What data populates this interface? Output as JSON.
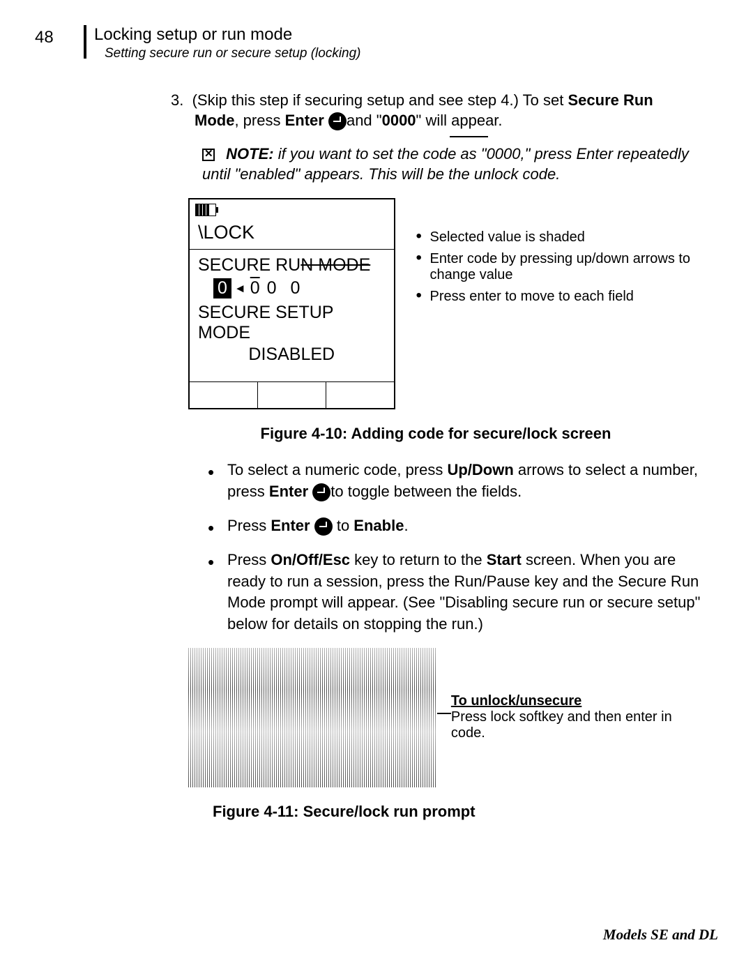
{
  "page_number": "48",
  "header": {
    "title": "Locking setup or run mode",
    "subtitle": "Setting secure run or secure setup (locking)"
  },
  "step3": {
    "number": "3.",
    "text_a": "(Skip this step if securing setup and see step 4.)   To set ",
    "text_b": "Secure Run Mode",
    "text_c": ", press ",
    "text_d": "Enter ",
    "text_e": "and \"",
    "text_f": "0000",
    "text_g": "\" will appear."
  },
  "note": {
    "label": "NOTE:",
    "text": "if you want to set the code as \"0000,\" press Enter repeatedly until \"enabled\" appears.  This will be the unlock code."
  },
  "lock_screen": {
    "title": "\\LOCK",
    "secure_run_a": "SECURE RU",
    "secure_run_b": "N MODE",
    "code_selected": "0",
    "code_d2": "0",
    "code_d3": "0",
    "code_d4": "0",
    "secure_setup": "SECURE SETUP MODE",
    "disabled": "DISABLED"
  },
  "annotations": {
    "item1": "Selected value is shaded",
    "item2": "Enter code by pressing up/down arrows to change value",
    "item3": "Press enter to move to each field"
  },
  "figure410": "Figure 4-10:  Adding code for secure/lock screen",
  "bullets": {
    "b1_a": "To select a numeric code, press ",
    "b1_b": "Up/Down",
    "b1_c": " arrows to select a number, press ",
    "b1_d": "Enter ",
    "b1_e": "to toggle between the fields.",
    "b2_a": "Press ",
    "b2_b": "Enter ",
    "b2_c": " to ",
    "b2_d": "Enable",
    "b2_e": ".",
    "b3_a": "Press ",
    "b3_b": "On/Off/Esc",
    "b3_c": " key to return to the ",
    "b3_d": "Start",
    "b3_e": " screen.  When you are ready to run a session, press the Run/Pause key and the Secure Run Mode prompt will appear.  (See \"Disabling secure run or secure setup\" below for details on stopping the run.)"
  },
  "unlock": {
    "title": "To unlock/unsecure",
    "text": "Press lock softkey and then enter in code."
  },
  "figure411": "Figure 4-11: Secure/lock run prompt",
  "footer": "Models SE and DL"
}
